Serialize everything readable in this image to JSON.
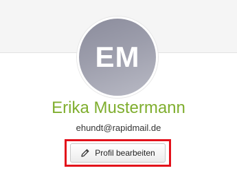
{
  "profile": {
    "initials": "EM",
    "name": "Erika Mustermann",
    "email": "ehundt@rapidmail.de",
    "edit_label": "Profil bearbeiten",
    "edit_icon": "pencil-icon"
  },
  "colors": {
    "name": "#7fae2e",
    "highlight": "#e3101a",
    "avatar": "#9d9eac"
  }
}
